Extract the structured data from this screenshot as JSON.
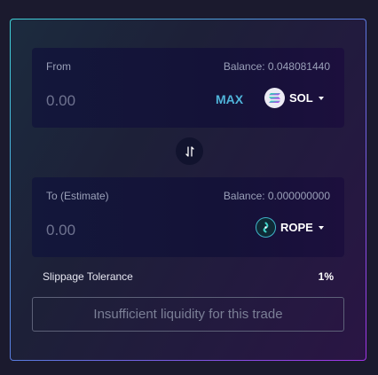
{
  "from": {
    "label": "From",
    "balance": "Balance: 0.048081440",
    "amount_placeholder": "0.00",
    "max_label": "MAX",
    "token": {
      "symbol": "SOL",
      "icon": "solana-logo-icon"
    }
  },
  "to": {
    "label": "To (Estimate)",
    "balance": "Balance: 0.000000000",
    "amount_placeholder": "0.00",
    "token": {
      "symbol": "ROPE",
      "icon": "rope-logo-icon"
    }
  },
  "swap": {
    "icon": "swap-direction-icon"
  },
  "slippage": {
    "label": "Slippage Tolerance",
    "value": "1%"
  },
  "action": {
    "label": "Insufficient liquidity for this trade"
  },
  "colors": {
    "accent_cyan": "#4fb3d9",
    "border_gradient_start": "#3fd3d8",
    "border_gradient_end": "#a234e6",
    "page_background": "#1b1a2e"
  }
}
